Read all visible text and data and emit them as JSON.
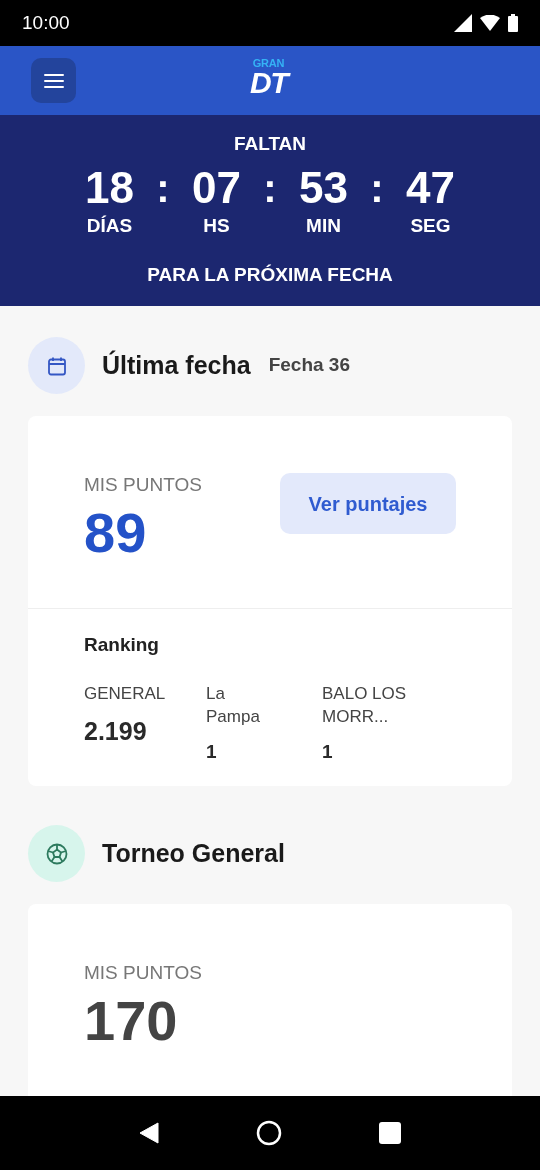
{
  "status_bar": {
    "time": "10:00"
  },
  "app_bar": {
    "logo_top": "GRAN",
    "logo_main": "DT"
  },
  "countdown": {
    "title": "FALTAN",
    "units": [
      {
        "value": "18",
        "label": "DÍAS"
      },
      {
        "value": "07",
        "label": "HS"
      },
      {
        "value": "53",
        "label": "MIN"
      },
      {
        "value": "47",
        "label": "SEG"
      }
    ],
    "separator": ":",
    "footer": "PARA LA PRÓXIMA FECHA"
  },
  "sections": [
    {
      "kind": "latest",
      "title": "Última fecha",
      "subtitle": "Fecha 36",
      "points_label": "MIS PUNTOS",
      "points": "89",
      "button": "Ver puntajes",
      "ranking": {
        "title": "Ranking",
        "columns": [
          {
            "label": "GENERAL",
            "value": "2.199"
          },
          {
            "label": "La Pampa",
            "value": "1"
          },
          {
            "label": "BALO LOS MORR...",
            "value": "1"
          }
        ]
      }
    },
    {
      "kind": "tournament",
      "title": "Torneo General",
      "points_label": "MIS PUNTOS",
      "points": "170"
    }
  ]
}
